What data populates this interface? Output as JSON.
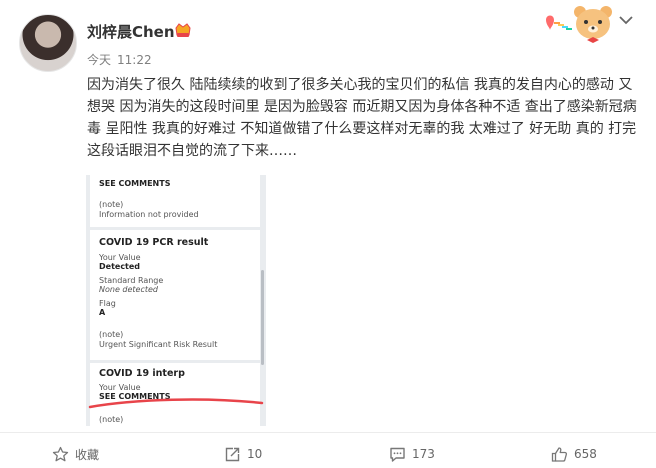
{
  "post": {
    "username": "刘梓晨Chen",
    "time_prefix": "今天",
    "time": "11:22",
    "text": "因为消失了很久 陆陆续续的收到了很多关心我的宝贝们的私信 我真的发自内心的感动 又想哭 因为消失的这段时间里 是因为脸毁容 而近期又因为身体各种不适 查出了感染新冠病毒 呈阳性 我真的好难过 不知道做错了什么要这样对无辜的我 太难过了 好无助 真的 打完这段话眼泪不自觉的流了下来……"
  },
  "attachment": {
    "card1_label": "SEE COMMENTS",
    "card1_note": "(note)",
    "card1_note_text": "Information not provided",
    "card2_title": "COVID 19 PCR result",
    "card2_value_label": "Your Value",
    "card2_value": "Detected",
    "card2_range_label": "Standard Range",
    "card2_range": "None detected",
    "card2_flag_label": "Flag",
    "card2_flag": "A",
    "card2_note": "(note)",
    "card2_note_text": "Urgent Significant Risk Result",
    "card3_title": "COVID 19 interp",
    "card3_value_label": "Your Value",
    "card3_value": "SEE COMMENTS",
    "card3_note": "(note)"
  },
  "actions": {
    "favorite_label": "收藏",
    "repost_count": "10",
    "comment_count": "173",
    "like_count": "658"
  },
  "colors": {
    "username": "#333333",
    "annotation_red": "#e8444a",
    "meta_gray": "#808080"
  },
  "icons": [
    "vip-badge-icon",
    "decorative-bear-icon",
    "chevron-down-icon",
    "star-icon",
    "repost-icon",
    "comment-icon",
    "thumbs-up-icon"
  ]
}
